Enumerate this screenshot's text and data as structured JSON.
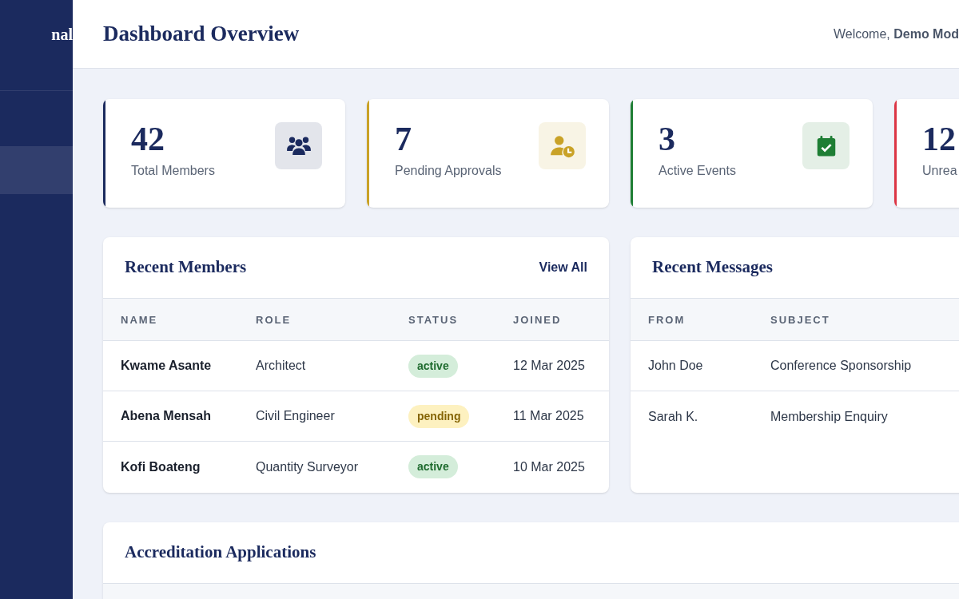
{
  "sidebar": {
    "brand": "nal"
  },
  "header": {
    "title": "Dashboard Overview",
    "welcome": "Welcome, **Demo Mod**"
  },
  "stats": [
    {
      "value": "42",
      "label": "Total Members",
      "color": "#1b2a5e"
    },
    {
      "value": "7",
      "label": "Pending Approvals",
      "color": "#c9a227"
    },
    {
      "value": "3",
      "label": "Active Events",
      "color": "#1e7e34"
    },
    {
      "value": "12",
      "label": "Unrea",
      "color": "#dc3545"
    }
  ],
  "recent_members": {
    "title": "Recent Members",
    "link": "View All",
    "columns": [
      "NAME",
      "ROLE",
      "STATUS",
      "JOINED"
    ],
    "rows": [
      {
        "name": "Kwame Asante",
        "role": "Architect",
        "status": "active",
        "kind": "success",
        "joined": "12 Mar 2025"
      },
      {
        "name": "Abena Mensah",
        "role": "Civil Engineer",
        "status": "pending",
        "kind": "warning",
        "joined": "11 Mar 2025"
      },
      {
        "name": "Kofi Boateng",
        "role": "Quantity Surveyor",
        "status": "active",
        "kind": "success",
        "joined": "10 Mar 2025"
      }
    ]
  },
  "recent_messages": {
    "title": "Recent Messages",
    "columns": [
      "FROM",
      "SUBJECT"
    ],
    "rows": [
      {
        "from": "John Doe",
        "subject": "Conference Sponsorship"
      },
      {
        "from": "Sarah K.",
        "subject": "Membership Enquiry"
      }
    ]
  },
  "accreditation": {
    "title": "Accreditation Applications"
  }
}
